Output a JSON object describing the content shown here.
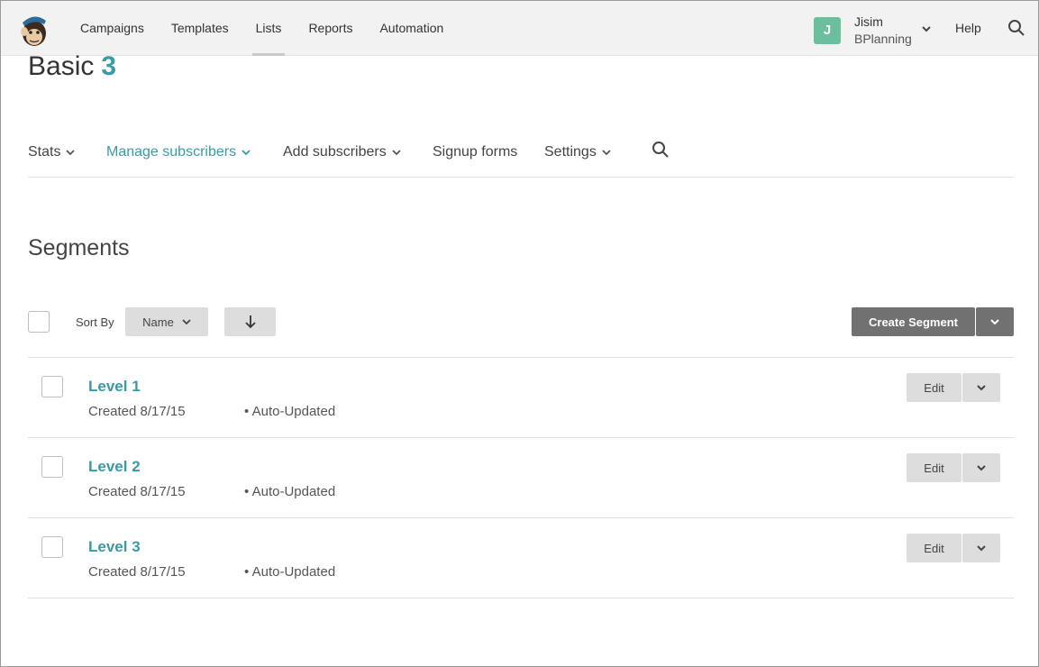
{
  "topnav": {
    "items": [
      {
        "label": "Campaigns"
      },
      {
        "label": "Templates"
      },
      {
        "label": "Lists"
      },
      {
        "label": "Reports"
      },
      {
        "label": "Automation"
      }
    ],
    "account": {
      "initial": "J",
      "name": "Jisim",
      "org": "BPlanning"
    },
    "help_label": "Help"
  },
  "page": {
    "title": "Basic",
    "count": "3"
  },
  "subnav": {
    "items": [
      {
        "label": "Stats"
      },
      {
        "label": "Manage subscribers"
      },
      {
        "label": "Add subscribers"
      },
      {
        "label": "Signup forms"
      },
      {
        "label": "Settings"
      }
    ]
  },
  "segments": {
    "title": "Segments",
    "sort_by_label": "Sort By",
    "sort_field": "Name",
    "create_label": "Create Segment",
    "rows": [
      {
        "name": "Level 1",
        "created": "Created 8/17/15",
        "type": "• Auto-Updated",
        "edit_label": "Edit"
      },
      {
        "name": "Level 2",
        "created": "Created 8/17/15",
        "type": "• Auto-Updated",
        "edit_label": "Edit"
      },
      {
        "name": "Level 3",
        "created": "Created 8/17/15",
        "type": "• Auto-Updated",
        "edit_label": "Edit"
      }
    ]
  },
  "colors": {
    "accent": "#3a9aa5",
    "avatar": "#6cbf9c",
    "primary_button": "#717171"
  }
}
